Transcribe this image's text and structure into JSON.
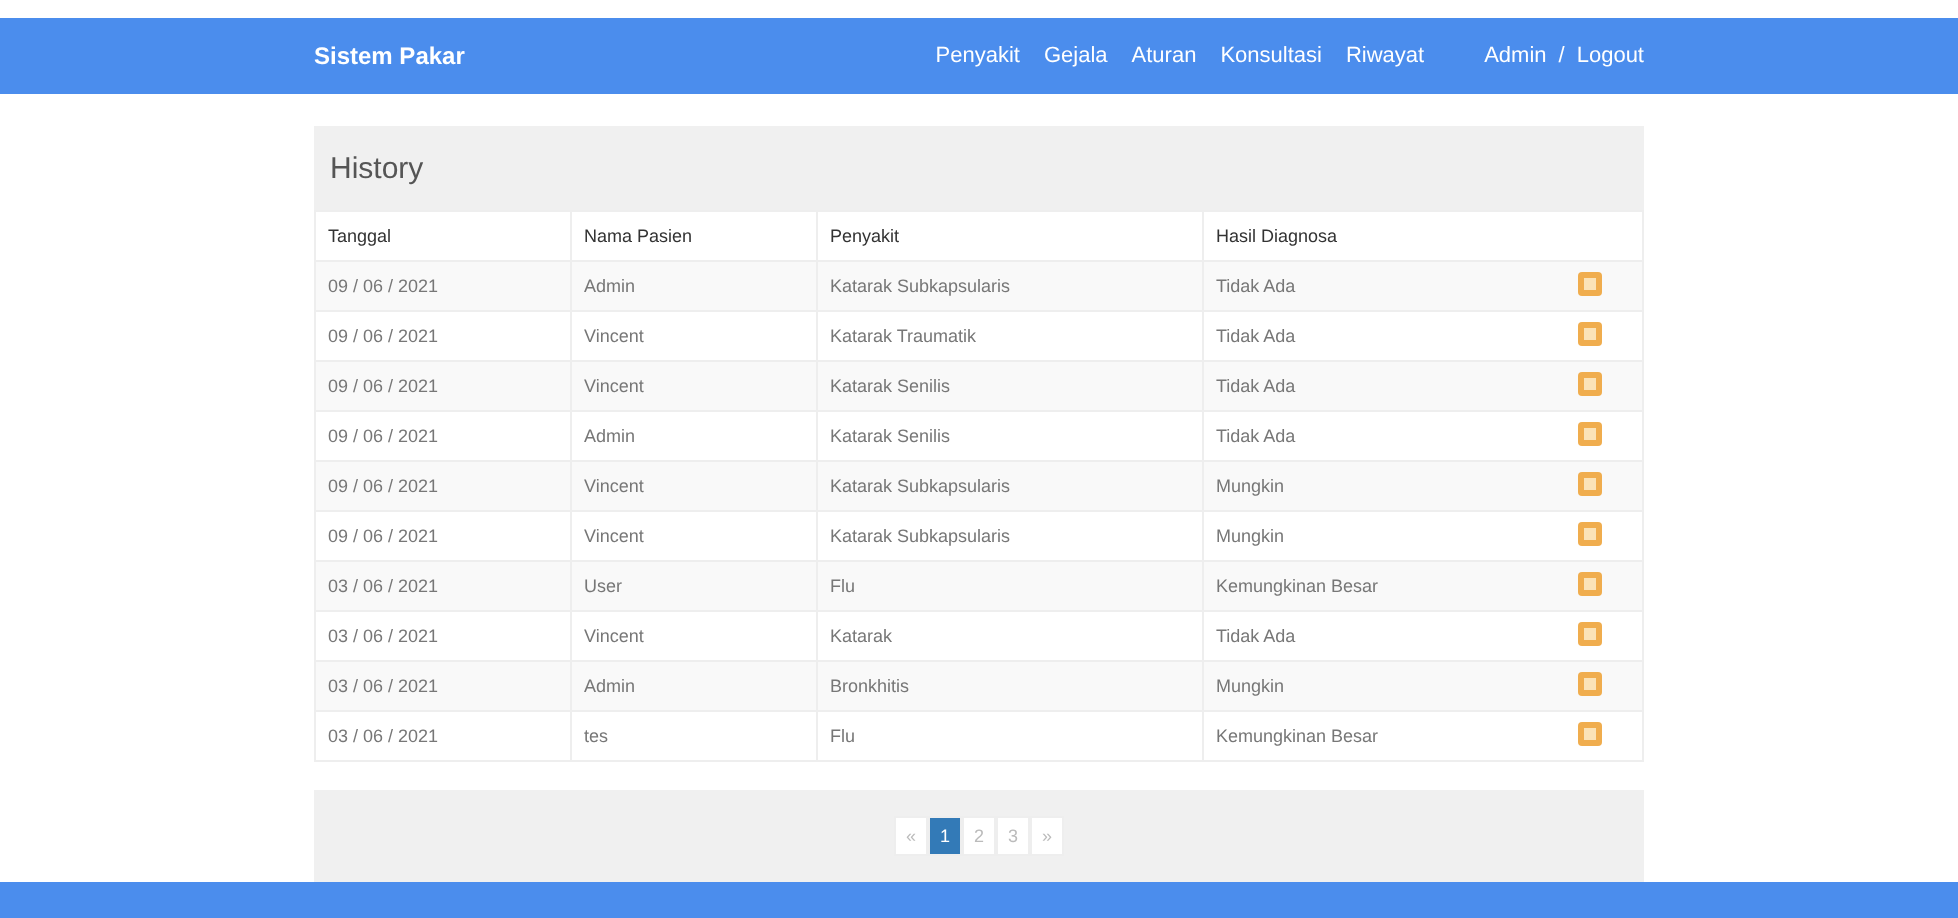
{
  "navbar": {
    "brand": "Sistem Pakar",
    "links": [
      "Penyakit",
      "Gejala",
      "Aturan",
      "Konsultasi",
      "Riwayat"
    ],
    "user": "Admin",
    "separator": "/",
    "logout": "Logout"
  },
  "panel": {
    "title": "History"
  },
  "table": {
    "columns": [
      "Tanggal",
      "Nama Pasien",
      "Penyakit",
      "Hasil Diagnosa"
    ],
    "rows": [
      {
        "cells": [
          "09 / 06 / 2021",
          "Admin",
          "Katarak Subkapsularis",
          "Tidak Ada"
        ]
      },
      {
        "cells": [
          "09 / 06 / 2021",
          "Vincent",
          "Katarak Traumatik",
          "Tidak Ada"
        ]
      },
      {
        "cells": [
          "09 / 06 / 2021",
          "Vincent",
          "Katarak Senilis",
          "Tidak Ada"
        ]
      },
      {
        "cells": [
          "09 / 06 / 2021",
          "Admin",
          "Katarak Senilis",
          "Tidak Ada"
        ]
      },
      {
        "cells": [
          "09 / 06 / 2021",
          "Vincent",
          "Katarak Subkapsularis",
          "Mungkin"
        ]
      },
      {
        "cells": [
          "09 / 06 / 2021",
          "Vincent",
          "Katarak Subkapsularis",
          "Mungkin"
        ]
      },
      {
        "cells": [
          "03 / 06 / 2021",
          "User",
          "Flu",
          "Kemungkinan Besar"
        ]
      },
      {
        "cells": [
          "03 / 06 / 2021",
          "Vincent",
          "Katarak",
          "Tidak Ada"
        ]
      },
      {
        "cells": [
          "03 / 06 / 2021",
          "Admin",
          "Bronkhitis",
          "Mungkin"
        ]
      },
      {
        "cells": [
          "03 / 06 / 2021",
          "tes",
          "Flu",
          "Kemungkinan Besar"
        ]
      }
    ]
  },
  "pagination": [
    {
      "label": "«",
      "selected": false
    },
    {
      "label": "1",
      "selected": true
    },
    {
      "label": "2",
      "selected": false
    },
    {
      "label": "3",
      "selected": false
    },
    {
      "label": "»",
      "selected": false
    }
  ]
}
